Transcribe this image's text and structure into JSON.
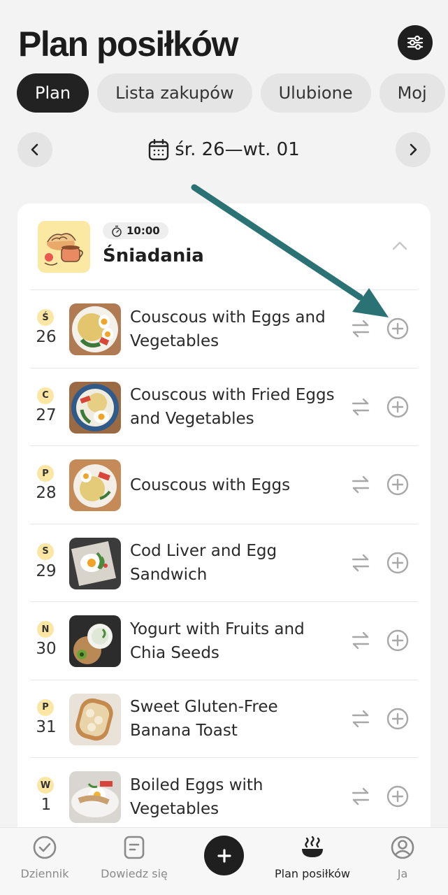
{
  "header": {
    "title": "Plan posiłków",
    "filter_icon": "sliders-icon"
  },
  "tabs": [
    {
      "label": "Plan",
      "active": true
    },
    {
      "label": "Lista zakupów",
      "active": false
    },
    {
      "label": "Ulubione",
      "active": false
    },
    {
      "label": "Moj",
      "active": false
    }
  ],
  "date_nav": {
    "range": "śr. 26—wt. 01",
    "prev_icon": "chevron-left-icon",
    "next_icon": "chevron-right-icon",
    "calendar_icon": "calendar-icon"
  },
  "meal": {
    "time": "10:00",
    "title": "Śniadania",
    "timer_icon": "stopwatch-icon"
  },
  "items": [
    {
      "day_letter": "Ś",
      "day_num": "26",
      "name": "Couscous with Eggs and Vegetables"
    },
    {
      "day_letter": "C",
      "day_num": "27",
      "name": "Couscous with Fried Eggs and Vegetables"
    },
    {
      "day_letter": "P",
      "day_num": "28",
      "name": "Couscous with Eggs"
    },
    {
      "day_letter": "S",
      "day_num": "29",
      "name": "Cod Liver and Egg Sandwich"
    },
    {
      "day_letter": "N",
      "day_num": "30",
      "name": "Yogurt with Fruits and Chia Seeds"
    },
    {
      "day_letter": "P",
      "day_num": "31",
      "name": "Sweet Gluten-Free Banana Toast"
    },
    {
      "day_letter": "W",
      "day_num": "1",
      "name": "Boiled Eggs with Vegetables"
    }
  ],
  "bottom_nav": [
    {
      "label": "Dziennik",
      "icon": "check-circle-icon"
    },
    {
      "label": "Dowiedz się",
      "icon": "article-icon"
    },
    {
      "label": "",
      "icon": "plus-icon"
    },
    {
      "label": "Plan posiłków",
      "icon": "bowl-icon",
      "active": true
    },
    {
      "label": "Ja",
      "icon": "profile-icon"
    }
  ],
  "colors": {
    "accent_dark": "#1f1f1f",
    "badge_yellow": "#fbe6a3",
    "annotation_arrow": "#2b7274"
  }
}
